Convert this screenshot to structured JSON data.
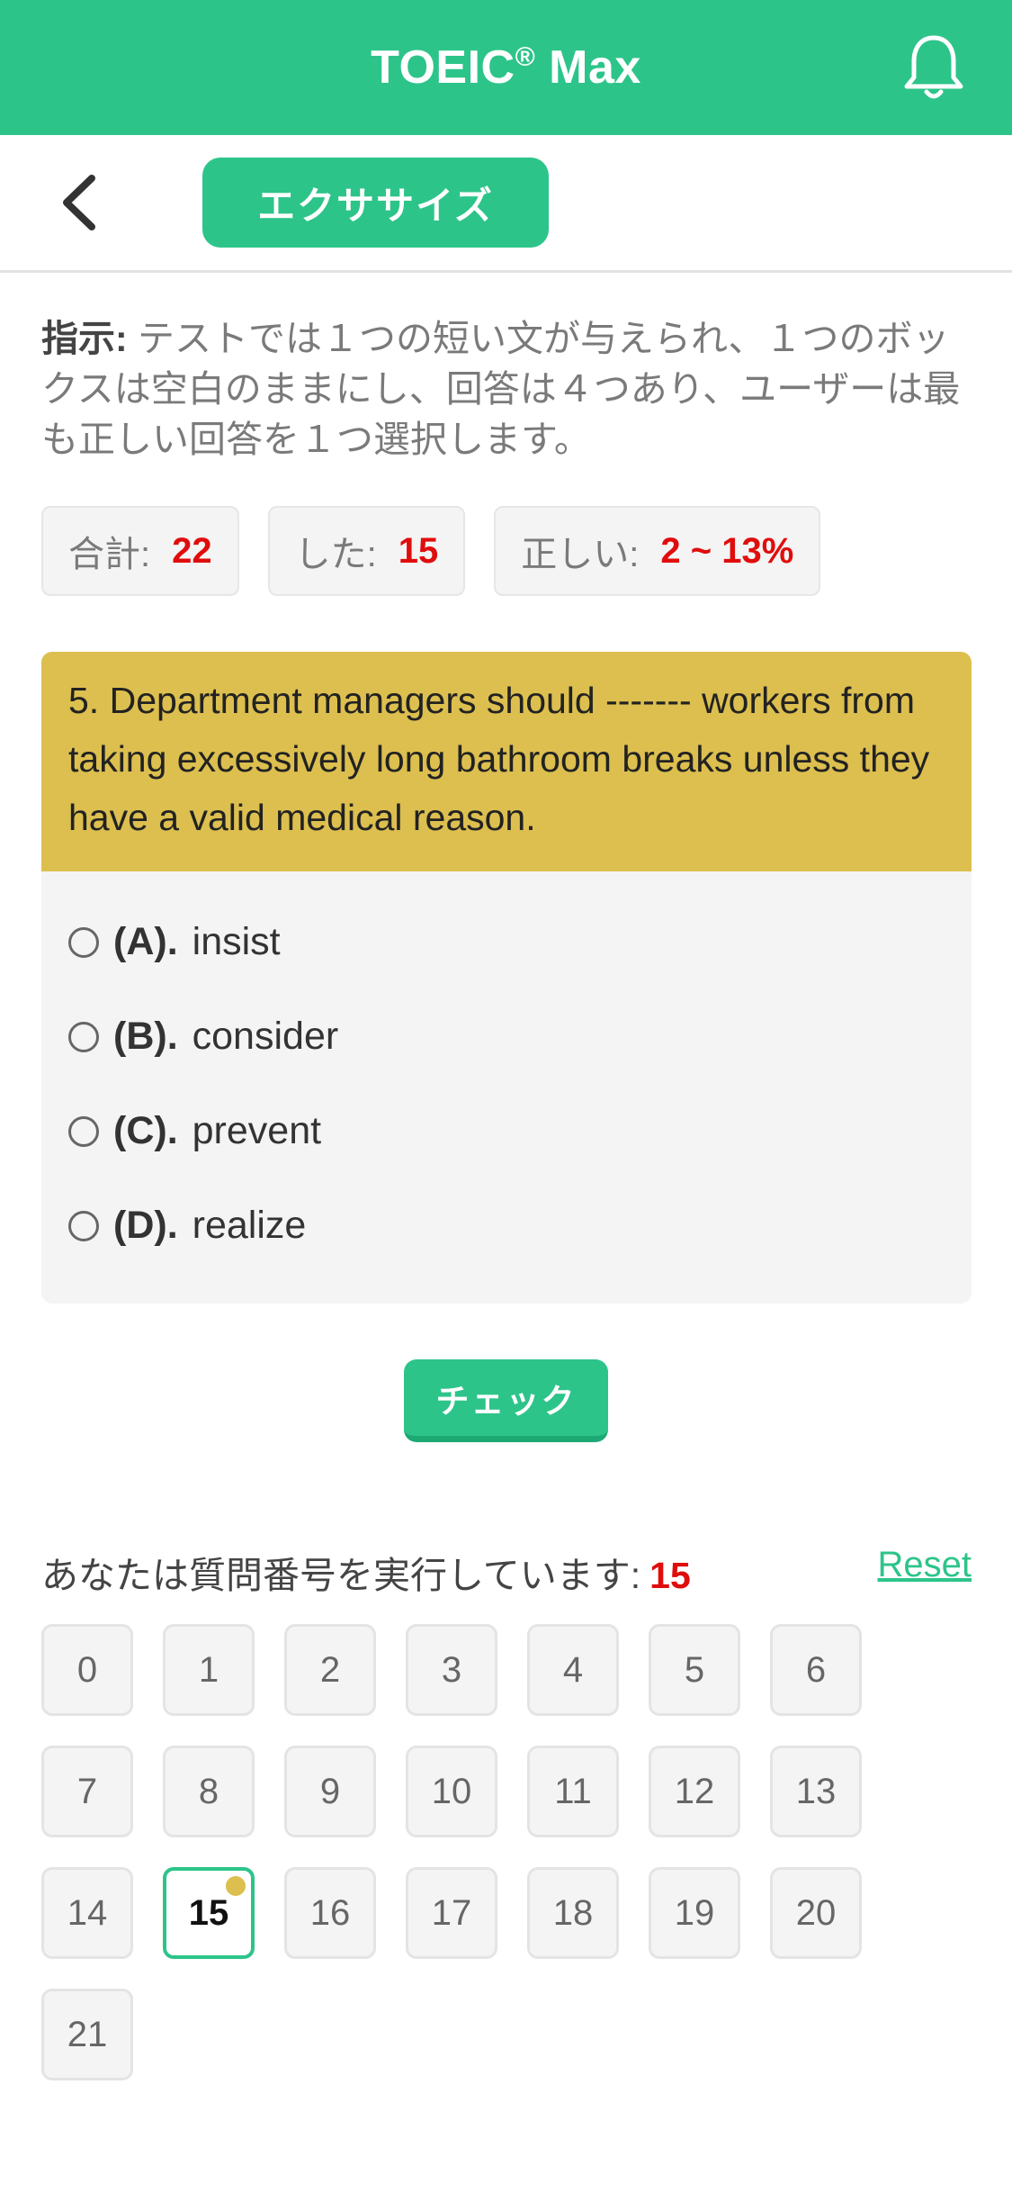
{
  "header": {
    "title": "TOEIC",
    "reg_mark": "®",
    "title_suffix": " Max"
  },
  "nav": {
    "tab_label": "エクササイズ"
  },
  "instruction": {
    "label": "指示:",
    "text": " テストでは１つの短い文が与えられ、１つのボックスは空白のままにし、回答は４つあり、ユーザーは最も正しい回答を１つ選択します。"
  },
  "stats": [
    {
      "label": "合計:",
      "value": "22"
    },
    {
      "label": "した:",
      "value": "15"
    },
    {
      "label": "正しい:",
      "value": "2 ~ 13%"
    }
  ],
  "question": {
    "text": "5. Department managers should ------- workers from taking excessively long bathroom breaks unless they have a valid medical reason.",
    "options": [
      {
        "letter": "(A).",
        "text": "insist"
      },
      {
        "letter": "(B).",
        "text": "consider"
      },
      {
        "letter": "(C).",
        "text": "prevent"
      },
      {
        "letter": "(D).",
        "text": "realize"
      }
    ]
  },
  "check_label": "チェック",
  "progress": {
    "label": "あなたは質問番号を実行しています:",
    "current": "15",
    "reset_label": "Reset"
  },
  "question_numbers": [
    "0",
    "1",
    "2",
    "3",
    "4",
    "5",
    "6",
    "7",
    "8",
    "9",
    "10",
    "11",
    "12",
    "13",
    "14",
    "15",
    "16",
    "17",
    "18",
    "19",
    "20",
    "21"
  ],
  "colors": {
    "primary": "#2dc48a",
    "question_bg": "#dcbf4f",
    "highlight_red": "#e00d0d"
  }
}
